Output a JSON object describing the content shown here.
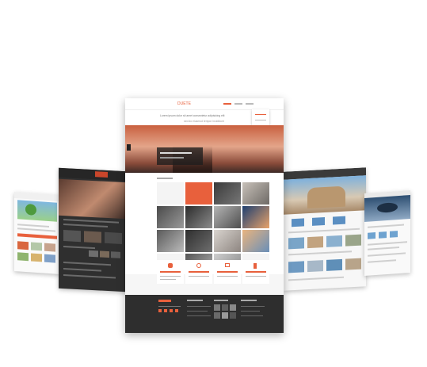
{
  "scene": {
    "kind": "responsive website template showcase",
    "colors": {
      "accent": "#e8603c",
      "dark": "#2e2e2e",
      "panel": "#f6f6f6",
      "sky": "#5aa5d6"
    }
  },
  "main_page": {
    "logo": "DUETE",
    "hero_line1": "Lorem ipsum dolor sit amet consectetur adipisicing elit",
    "hero_line2": "sed do eiusmod tempor incididunt"
  }
}
